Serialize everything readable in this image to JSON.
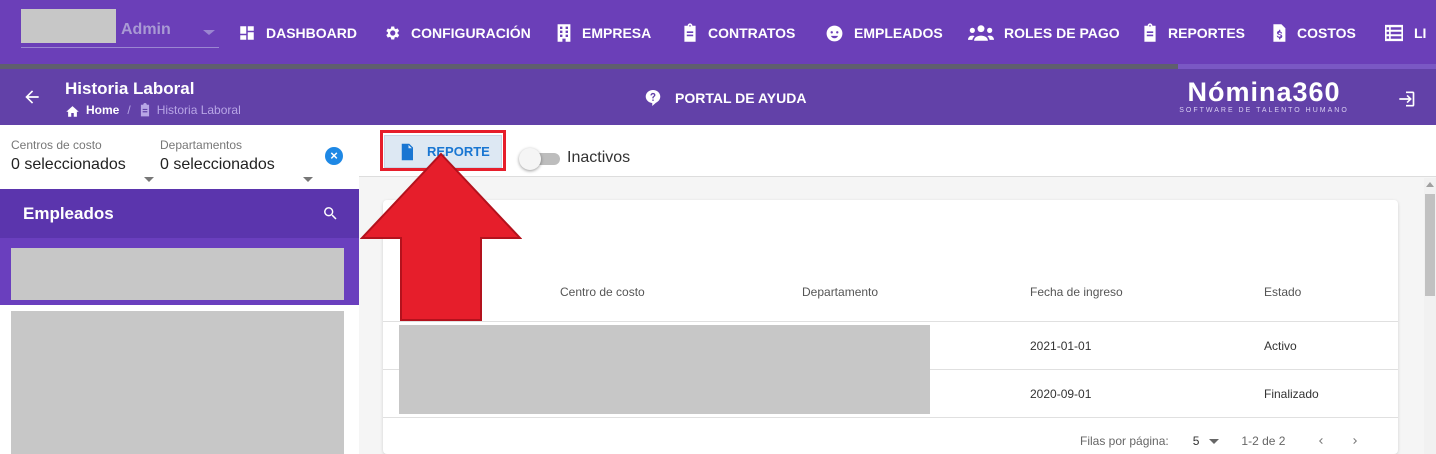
{
  "topnav": {
    "user_role": "Admin",
    "items": [
      {
        "label": "DASHBOARD",
        "icon": "dashboard-icon"
      },
      {
        "label": "CONFIGURACIÓN",
        "icon": "gear-icon"
      },
      {
        "label": "EMPRESA",
        "icon": "building-icon"
      },
      {
        "label": "CONTRATOS",
        "icon": "clipboard-icon"
      },
      {
        "label": "EMPLEADOS",
        "icon": "face-icon"
      },
      {
        "label": "ROLES DE PAGO",
        "icon": "people-icon"
      },
      {
        "label": "REPORTES",
        "icon": "clipboard-icon"
      },
      {
        "label": "COSTOS",
        "icon": "dollar-doc-icon"
      },
      {
        "label": "LI",
        "icon": "list-icon"
      }
    ],
    "progress": 0.82
  },
  "crumbbar": {
    "title": "Historia Laboral",
    "home": "Home",
    "current": "Historia Laboral",
    "help": "PORTAL DE AYUDA",
    "brand": "Nómina360",
    "brand_tagline": "SOFTWARE DE TALENTO HUMANO"
  },
  "filters": {
    "cost_centers_label": "Centros de costo",
    "cost_centers_value": "0 seleccionados",
    "departments_label": "Departamentos",
    "departments_value": "0 seleccionados"
  },
  "employees": {
    "title": "Empleados"
  },
  "toolbar": {
    "report_label": "REPORTE",
    "inactive_label": "Inactivos",
    "inactive_on": false
  },
  "table": {
    "columns": [
      "Centro de costo",
      "Departamento",
      "Fecha de ingreso",
      "Estado"
    ],
    "rows": [
      {
        "fecha": "2021-01-01",
        "estado": "Activo"
      },
      {
        "fecha": "2020-09-01",
        "estado": "Finalizado"
      }
    ],
    "rows_per_page_label": "Filas por página:",
    "rows_per_page": "5",
    "range": "1-2 de 2"
  },
  "colors": {
    "nav_bg": "#6b3fb8",
    "crumb_bg": "#6241a8",
    "highlight": "#e61e2b",
    "accent": "#1976d2"
  }
}
